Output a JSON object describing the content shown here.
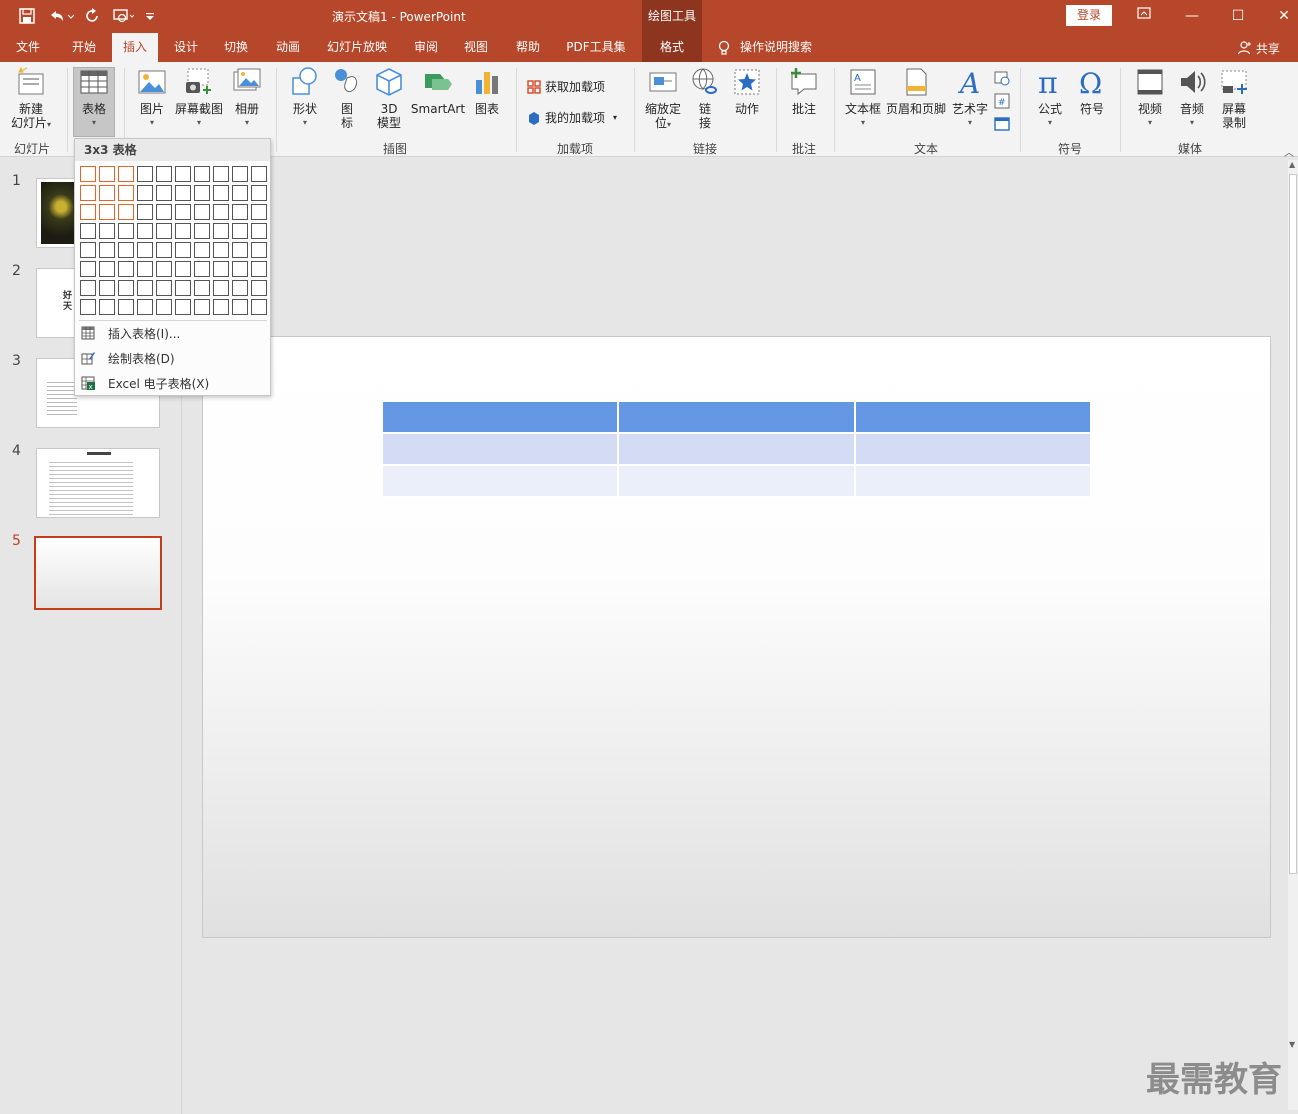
{
  "titlebar": {
    "doc_title": "演示文稿1  -  PowerPoint",
    "tool_context": "绘图工具",
    "login": "登录",
    "min_glyph": "—",
    "max_glyph": "☐",
    "close_glyph": "✕"
  },
  "tabs": {
    "file": "文件",
    "home": "开始",
    "insert": "插入",
    "design": "设计",
    "transitions": "切换",
    "animations": "动画",
    "slideshow": "幻灯片放映",
    "review": "审阅",
    "view": "视图",
    "help": "帮助",
    "pdf": "PDF工具集",
    "format": "格式",
    "search": "操作说明搜索",
    "share": "共享"
  },
  "ribbon": {
    "new_slide": "新建",
    "new_slide2": "幻灯片",
    "table": "表格",
    "picture": "图片",
    "screenshot": "屏幕截图",
    "album": "相册",
    "shapes": "形状",
    "icons": "图",
    "icons2": "标",
    "model3d": "3D",
    "model3d2": "模型",
    "smartart": "SmartArt",
    "chart": "图表",
    "get_addins": "获取加载项",
    "my_addins": "我的加载项",
    "zoom": "缩放定",
    "zoom2": "位",
    "link": "链",
    "link2": "接",
    "action": "动作",
    "comment": "批注",
    "textbox": "文本框",
    "header_footer": "页眉和页脚",
    "wordart": "艺术字",
    "equation": "公式",
    "symbol": "符号",
    "video": "视频",
    "audio": "音频",
    "screen_rec": "屏幕",
    "screen_rec2": "录制",
    "groups": {
      "slides": "幻灯片",
      "illustrations": "插图",
      "addins": "加载项",
      "links": "链接",
      "comments": "批注",
      "text": "文本",
      "symbols": "符号",
      "media": "媒体"
    }
  },
  "thumbnails": {
    "numbers": [
      "1",
      "2",
      "3",
      "4",
      "5"
    ],
    "slide2_text_a": "好",
    "slide2_text_b": "天"
  },
  "table_dropdown": {
    "header": "3x3 表格",
    "rows": 8,
    "cols": 10,
    "selected_rows": 3,
    "selected_cols": 3,
    "insert_table": "插入表格(I)...",
    "draw_table": "绘制表格(D)",
    "excel_table": "Excel 电子表格(X)"
  },
  "slide_table": {
    "rows": 3,
    "cols": 3,
    "header_color": "#6498e4",
    "row1_color": "#d3dcf4",
    "row2_color": "#ebeff9"
  },
  "colors": {
    "accent": "#b7472a",
    "context": "#8e3520",
    "selection": "#e1662a"
  },
  "watermark": "最需教育"
}
